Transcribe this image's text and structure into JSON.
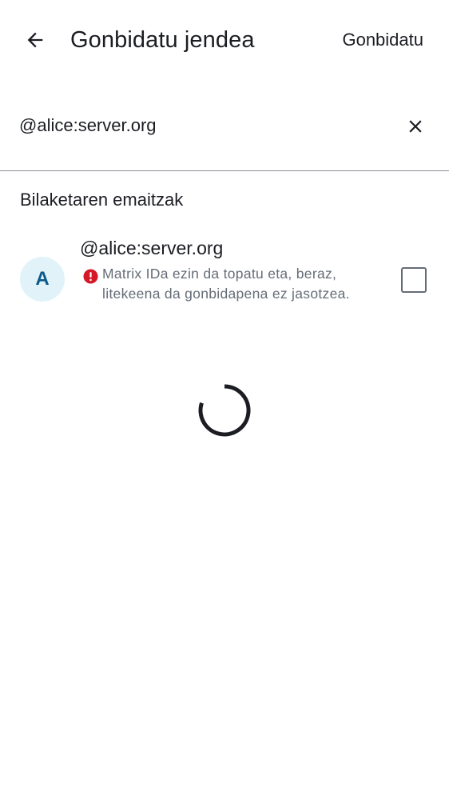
{
  "header": {
    "title": "Gonbidatu jendea",
    "invite_label": "Gonbidatu"
  },
  "search": {
    "value": "@alice:server.org"
  },
  "results": {
    "section_title": "Bilaketaren emaitzak",
    "items": [
      {
        "avatar_initial": "A",
        "user_id": "@alice:server.org",
        "warning": "Matrix IDa ezin da topatu eta, beraz, litekeena da gonbidapena ez jasotzea.",
        "checked": false
      }
    ]
  },
  "colors": {
    "accent_text": "#1b1d22",
    "secondary_text": "#656d77",
    "error": "#d51928",
    "avatar_bg": "#e1f3f9",
    "avatar_fg": "#0b5a8b"
  },
  "icons": [
    "back-arrow-icon",
    "close-icon",
    "error-icon",
    "loading-spinner"
  ]
}
